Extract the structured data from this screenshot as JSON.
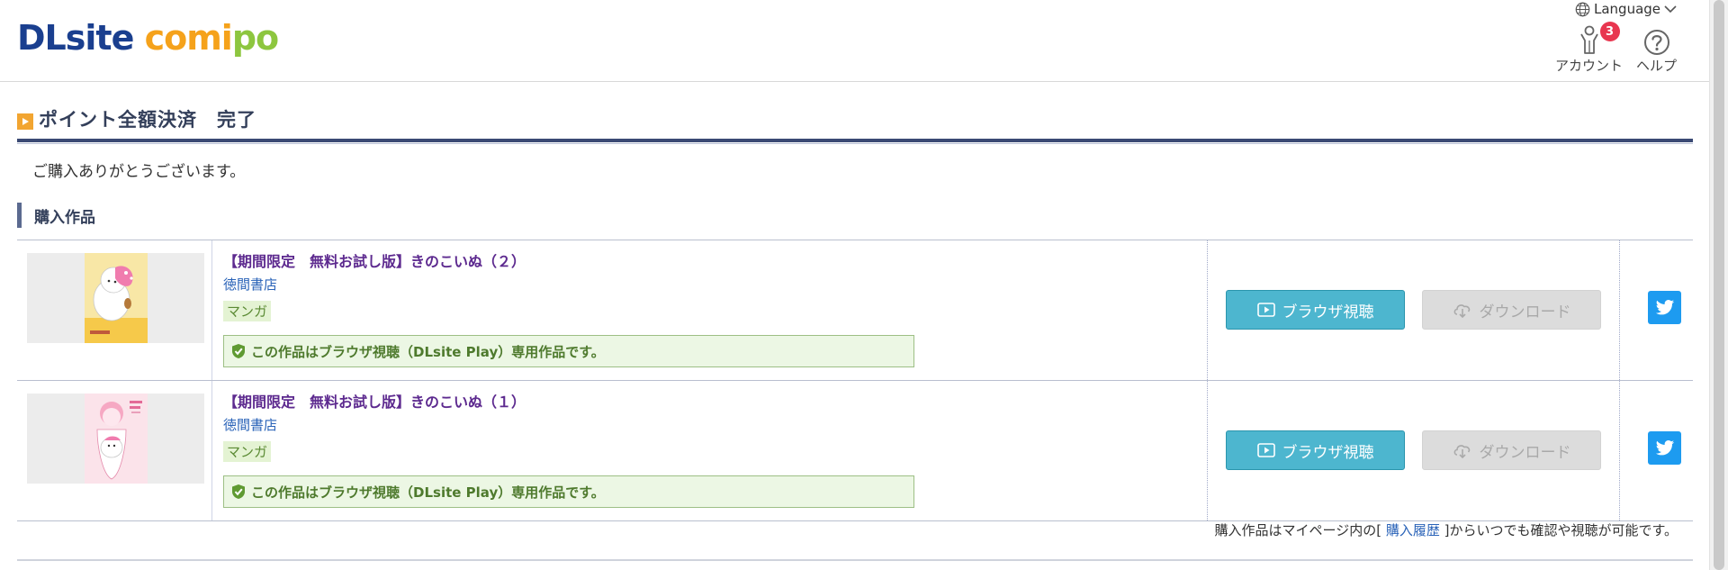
{
  "header": {
    "logo_part1": "DLsite",
    "logo_part2": "comi",
    "logo_part3": "po",
    "language_label": "Language",
    "account_label": "アカウント",
    "account_badge": "3",
    "help_label": "ヘルプ"
  },
  "page": {
    "title": "ポイント全額決済　完了",
    "thanks": "ご購入ありがとうございます。",
    "section_title": "購入作品"
  },
  "works": [
    {
      "title": "【期間限定　無料お試し版】きのこいぬ（２）",
      "maker": "徳間書店",
      "genre": "マンガ",
      "notice": "この作品はブラウザ視聴（DLsite Play）専用作品です。",
      "view_label": "ブラウザ視聴",
      "download_label": "ダウンロード"
    },
    {
      "title": "【期間限定　無料お試し版】きのこいぬ（１）",
      "maker": "徳間書店",
      "genre": "マンガ",
      "notice": "この作品はブラウザ視聴（DLsite Play）専用作品です。",
      "view_label": "ブラウザ視聴",
      "download_label": "ダウンロード"
    }
  ],
  "footer": {
    "before": "購入作品はマイページ内の[ ",
    "link": "購入履歴",
    "after": " ]からいつでも確認や視聴が可能です。"
  },
  "colors": {
    "view_button": "#4db6cf",
    "twitter": "#1d9bf0",
    "badge": "#e8364f",
    "title_bar": "#3b4a74"
  }
}
